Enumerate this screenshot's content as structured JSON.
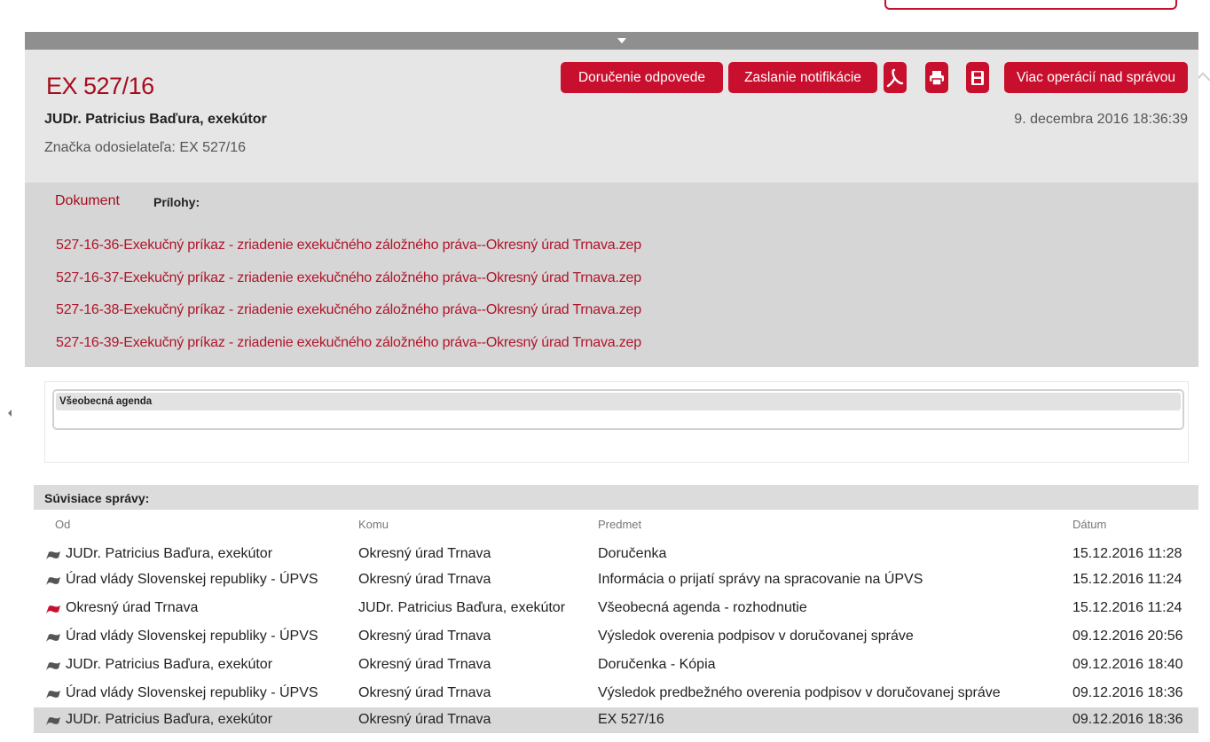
{
  "message": {
    "title": "EX 527/16",
    "sender": "JUDr. Patricius Baďura, exekútor",
    "sender_ref": "Značka odosielateľa: EX 527/16",
    "date": "9. decembra 2016 18:36:39"
  },
  "toolbar": {
    "deliver_reply": "Doručenie odpovede",
    "send_notification": "Zaslanie notifikácie",
    "more_ops": "Viac operácií nad správou"
  },
  "attachments": {
    "document_tab": "Dokument",
    "label": "Prílohy:",
    "files": [
      "527-16-36-Exekučný príkaz - zriadenie exekučného záložného práva--Okresný úrad Trnava.zep",
      "527-16-37-Exekučný príkaz - zriadenie exekučného záložného práva--Okresný úrad Trnava.zep",
      "527-16-38-Exekučný príkaz - zriadenie exekučného záložného práva--Okresný úrad Trnava.zep",
      "527-16-39-Exekučný príkaz - zriadenie exekučného záložného práva--Okresný úrad Trnava.zep"
    ]
  },
  "agenda": {
    "title": "Všeobecná agenda"
  },
  "related": {
    "title": "Súvisiace správy:",
    "columns": {
      "from": "Od",
      "to": "Komu",
      "subject": "Predmet",
      "date": "Dátum"
    },
    "rows": [
      {
        "from": "JUDr. Patricius Baďura, exekútor",
        "to": "Okresný úrad Trnava",
        "subject": "Doručenka",
        "date": "15.12.2016 11:28",
        "flag_color": "#555555"
      },
      {
        "from": "Úrad vlády Slovenskej republiky - ÚPVS",
        "to": "Okresný úrad Trnava",
        "subject": "Informácia o prijatí správy na spracovanie na ÚPVS",
        "date": "15.12.2016 11:24",
        "flag_color": "#555555"
      },
      {
        "from": "Okresný úrad Trnava",
        "to": "JUDr. Patricius Baďura, exekútor",
        "subject": "Všeobecná agenda - rozhodnutie",
        "date": "15.12.2016 11:24",
        "flag_color": "#c8102e"
      },
      {
        "from": "Úrad vlády Slovenskej republiky - ÚPVS",
        "to": "Okresný úrad Trnava",
        "subject": "Výsledok overenia podpisov v doručovanej správe",
        "date": "09.12.2016 20:56",
        "flag_color": "#555555"
      },
      {
        "from": "JUDr. Patricius Baďura, exekútor",
        "to": "Okresný úrad Trnava",
        "subject": "Doručenka - Kópia",
        "date": "09.12.2016 18:40",
        "flag_color": "#555555"
      },
      {
        "from": "Úrad vlády Slovenskej republiky - ÚPVS",
        "to": "Okresný úrad Trnava",
        "subject": "Výsledok predbežného overenia podpisov v doručovanej správe",
        "date": "09.12.2016 18:36",
        "flag_color": "#555555"
      },
      {
        "from": "JUDr. Patricius Baďura, exekútor",
        "to": "Okresný úrad Trnava",
        "subject": "EX 527/16",
        "date": "09.12.2016 18:36",
        "flag_color": "#555555",
        "selected": true
      }
    ]
  },
  "colors": {
    "accent": "#c8102e",
    "title_red": "#a50d1e"
  },
  "icons": [
    "pdf-icon",
    "print-icon",
    "save-icon",
    "flag-icon",
    "collapse-arrow-icon"
  ]
}
